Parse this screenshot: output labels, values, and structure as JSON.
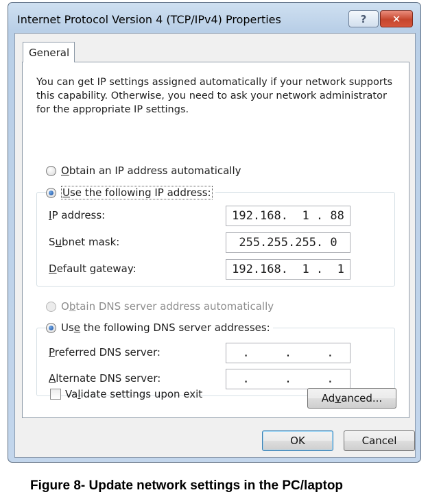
{
  "window": {
    "title": "Internet Protocol Version 4 (TCP/IPv4) Properties",
    "help_label": "?",
    "close_label": "✕"
  },
  "tab": {
    "label": "General"
  },
  "intro_text": "You can get IP settings assigned automatically if your network supports this capability. Otherwise, you need to ask your network administrator for the appropriate IP settings.",
  "ip_section": {
    "obtain_auto": {
      "pre": "",
      "key": "O",
      "post": "btain an IP address automatically",
      "checked": false
    },
    "use_following": {
      "pre": "",
      "key": "U",
      "post": "se the following IP address:",
      "checked": true
    },
    "fields": [
      {
        "pre": "",
        "key": "I",
        "post": "P address:",
        "value": "192.168.  1 . 88"
      },
      {
        "pre": "S",
        "key": "u",
        "post": "bnet mask:",
        "value": "255.255.255. 0"
      },
      {
        "pre": "",
        "key": "D",
        "post": "efault gateway:",
        "value": "192.168.  1 .  1"
      }
    ]
  },
  "dns_section": {
    "obtain_auto": {
      "pre": "O",
      "key": "b",
      "post": "tain DNS server address automatically",
      "checked": false,
      "disabled": true
    },
    "use_following": {
      "pre": "Us",
      "key": "e",
      "post": " the following DNS server addresses:",
      "checked": true
    },
    "fields": [
      {
        "pre": "",
        "key": "P",
        "post": "referred DNS server:",
        "value": "  .     .     .  "
      },
      {
        "pre": "",
        "key": "A",
        "post": "lternate DNS server:",
        "value": "  .     .     .  "
      }
    ]
  },
  "validate": {
    "pre": "Va",
    "key": "l",
    "post": "idate settings upon exit",
    "checked": false
  },
  "buttons": {
    "advanced": {
      "pre": "Ad",
      "key": "v",
      "post": "anced..."
    },
    "ok": "OK",
    "cancel": "Cancel"
  },
  "caption": "Figure 8- Update network settings in the PC/laptop",
  "colors": {
    "title_bar": "#c3d6ec",
    "close_button": "#c6462d",
    "panel": "#ffffff",
    "dialog_bg": "#f0f0f0"
  }
}
